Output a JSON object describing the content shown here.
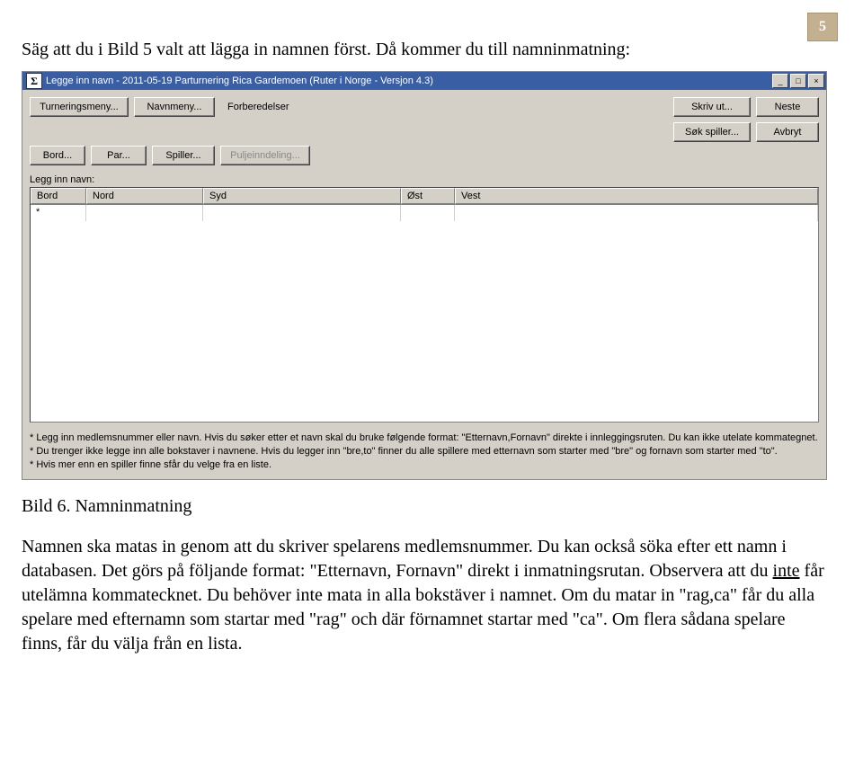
{
  "page_number": "5",
  "intro": "Säg att du i Bild 5 valt att lägga in namnen först. Då kommer du till namninmatning:",
  "window": {
    "title": "Legge inn navn - 2011-05-19 Parturnering Rica Gardemoen  (Ruter i Norge - Versjon 4.3)",
    "min": "_",
    "max": "□",
    "close": "×"
  },
  "toolbar": {
    "turneringsmeny": "Turneringsmeny...",
    "navnmeny": "Navnmeny...",
    "forberedelser": "Forberedelser",
    "skriv_ut": "Skriv ut...",
    "neste": "Neste",
    "bord": "Bord...",
    "par": "Par...",
    "spiller": "Spiller...",
    "puljeinndeling": "Puljeinndeling...",
    "sok_spiller": "Søk spiller...",
    "avbryt": "Avbryt"
  },
  "legg_inn_label": "Legg inn navn:",
  "columns": {
    "bord": "Bord",
    "nord": "Nord",
    "syd": "Syd",
    "ost": "Øst",
    "vest": "Vest"
  },
  "first_cell": "*",
  "hints": {
    "l1": "* Legg inn medlemsnummer eller navn. Hvis du søker etter et navn skal du bruke følgende format: \"Etternavn,Fornavn\" direkte i innleggingsruten. Du kan ikke utelate kommategnet.",
    "l2": "* Du trenger ikke legge inn alle bokstaver i navnene. Hvis du legger inn \"bre,to\" finner du alle spillere med etternavn som starter med \"bre\" og fornavn som starter med \"to\".",
    "l3": "* Hvis mer enn en spiller finne sfår du velge fra en liste."
  },
  "caption": "Bild 6. Namninmatning",
  "body": {
    "p1a": "Namnen ska matas in genom att du skriver spelarens medlemsnummer. Du kan också söka efter ett namn i databasen. Det görs på följande format: \"Etternavn, Fornavn\" direkt i inmatningsrutan. Observera att du ",
    "p1_u": "inte",
    "p1b": " får utelämna kommatecknet. Du behöver inte mata in alla bokstäver i namnet. Om du matar in \"rag,ca\" får du alla spelare med efternamn som startar med \"rag\" och där förnamnet startar med \"ca\". Om flera sådana spelare finns, får du välja från en lista."
  }
}
